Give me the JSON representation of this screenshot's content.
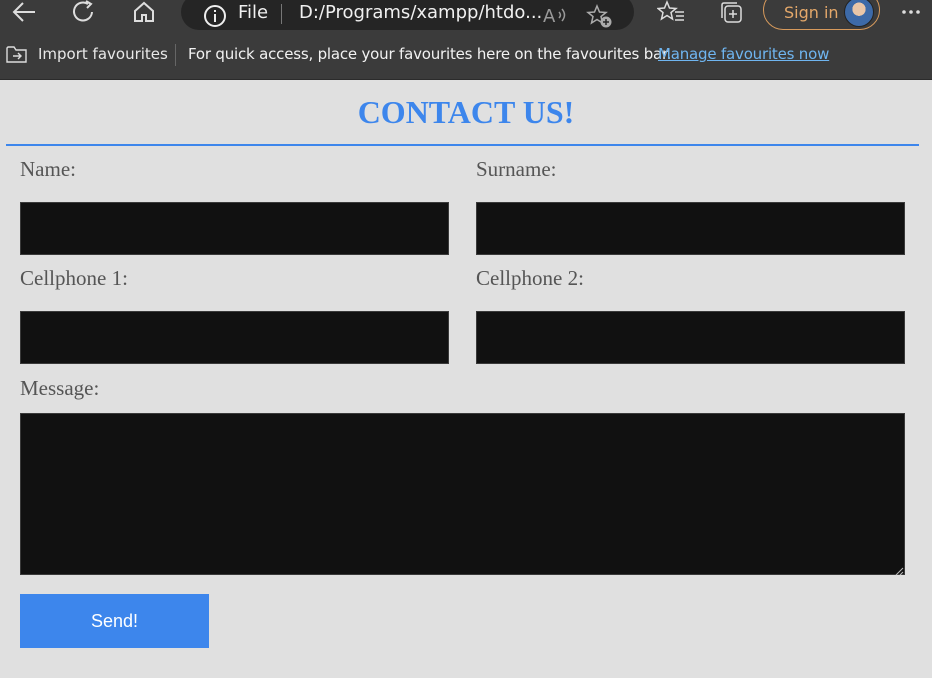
{
  "browser": {
    "address_bar": {
      "scheme_label": "File",
      "url": "D:/Programs/xampp/htdo..."
    },
    "sign_in_label": "Sign in",
    "favourites_bar": {
      "import_label": "Import favourites",
      "hint": "For quick access, place your favourites here on the favourites bar.",
      "manage_link": "Manage favourites now"
    }
  },
  "page": {
    "title": "CONTACT US!",
    "form": {
      "name_label": "Name:",
      "name_value": "",
      "surname_label": "Surname:",
      "surname_value": "",
      "cell1_label": "Cellphone 1:",
      "cell1_value": "",
      "cell2_label": "Cellphone 2:",
      "cell2_value": "",
      "message_label": "Message:",
      "message_value": "",
      "submit_label": "Send!"
    }
  },
  "colors": {
    "accent": "#3d86ec",
    "field_bg": "#111111",
    "page_bg": "#e0e0e0",
    "chrome_bg": "#3b3b3b"
  }
}
